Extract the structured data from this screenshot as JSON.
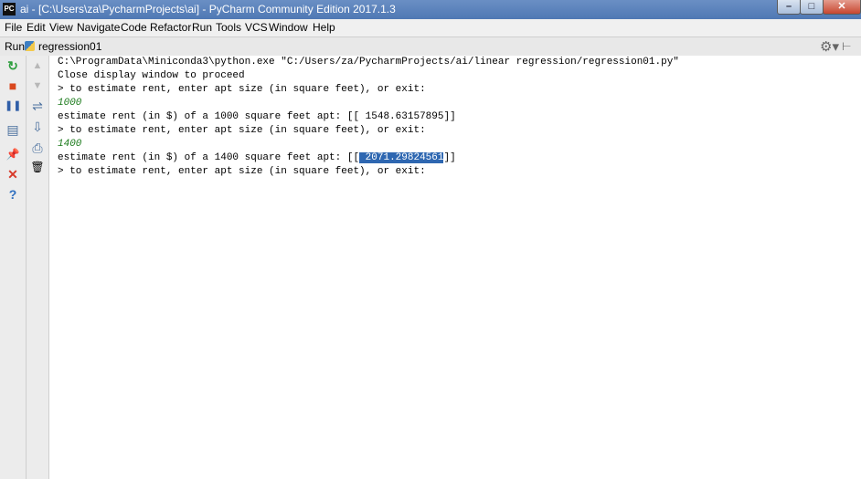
{
  "window": {
    "app_icon_text": "PC",
    "title": "ai - [C:\\Users\\za\\PycharmProjects\\ai] - PyCharm Community Edition 2017.1.3",
    "minimize_glyph": "–",
    "maximize_glyph": "□",
    "close_glyph": "✕"
  },
  "menu": [
    "File",
    "Edit",
    "View",
    "Navigate",
    "Code",
    "Refactor",
    "Run",
    "Tools",
    "VCS",
    "Window",
    "Help"
  ],
  "run_panel": {
    "label": "Run",
    "config_name": "regression01",
    "settings_glyph": "⚙▾",
    "hide_glyph": "⊢"
  },
  "toolbar_left": {
    "rerun": "↻",
    "stop": "■",
    "pause": "❚❚",
    "layout": "▤",
    "pin": "📌",
    "close": "✕",
    "help": "?"
  },
  "toolbar_left2": {
    "up": "▲",
    "down": "▼",
    "wrap": "⇌",
    "export": "⇩",
    "print": "⎙",
    "trash": "🗑"
  },
  "console": {
    "cmd": "C:\\ProgramData\\Miniconda3\\python.exe \"C:/Users/za/PycharmProjects/ai/linear regression/regression01.py\"",
    "line2": "Close display window to proceed",
    "prompt": "> to estimate rent, enter apt size (in square feet), or exit:",
    "input1": "1000",
    "result1": "estimate rent (in $) of a 1000 square feet apt: [[ 1548.63157895]]",
    "prompt2": "> to estimate rent, enter apt size (in square feet), or exit:",
    "input2": "1400",
    "result2_prefix": "estimate rent (in $) of a 1400 square feet apt: [[",
    "result2_value": " 2071.29824561",
    "result2_suffix": "]]",
    "prompt3": "> to estimate rent, enter apt size (in square feet), or exit:"
  }
}
